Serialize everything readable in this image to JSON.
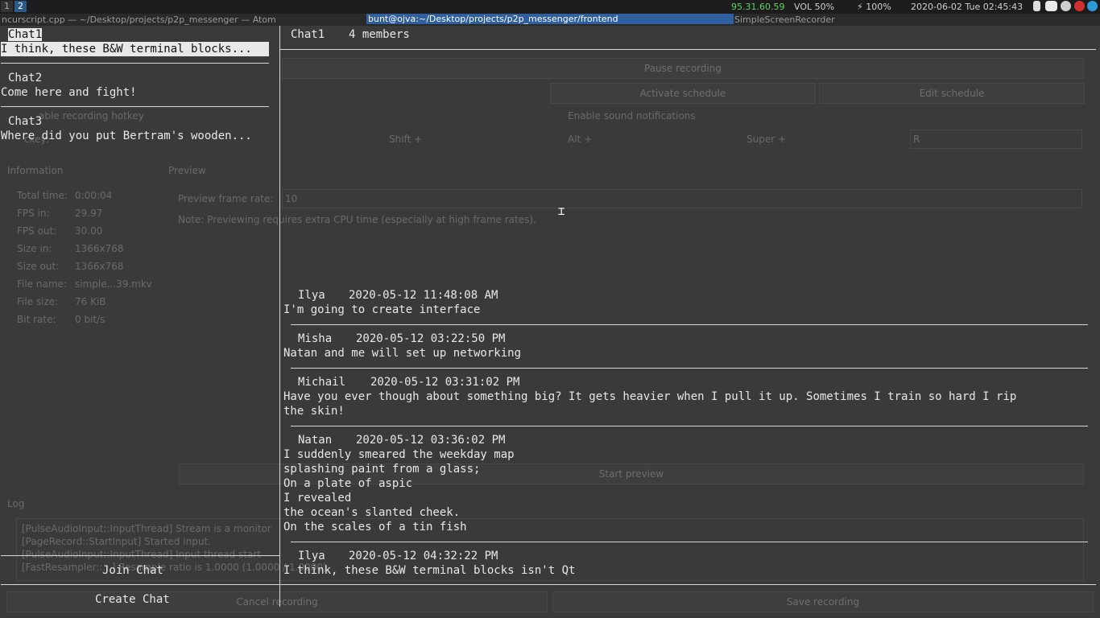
{
  "topbar": {
    "workspaces": [
      "1",
      "2"
    ],
    "ip": "95.31.60.59",
    "volume": "VOL 50%",
    "battery": "⚡ 100%",
    "datetime": "2020-06-02 Tue 02:45:43",
    "tray_icons": [
      "bluetooth-icon",
      "discord-icon",
      "steam-icon",
      "record-icon",
      "telegram-icon"
    ]
  },
  "windows": {
    "atom": "ncurscript.cpp — ~/Desktop/projects/p2p_messenger — Atom",
    "terminal": "bunt@ojva:~/Desktop/projects/p2p_messenger/frontend",
    "ssr": "SimpleScreenRecorder"
  },
  "background": {
    "pause_recording": "Pause recording",
    "activate_schedule": "Activate schedule",
    "edit_schedule": "Edit schedule",
    "enable_sound": "Enable sound notifications",
    "enable_hotkey": "able recording hotkey",
    "hotkey_label": "ckey:",
    "shift": "Shift +",
    "alt": "Alt +",
    "super": "Super +",
    "key": "R",
    "information": "Information",
    "preview": "Preview",
    "preview_rate_label": "Preview frame rate:",
    "preview_rate_value": "10",
    "preview_note": "Note: Previewing requires extra CPU time (especially at high frame rates).",
    "info_rows": [
      {
        "label": "Total time:",
        "value": "0:00:04"
      },
      {
        "label": "FPS in:",
        "value": "29.97"
      },
      {
        "label": "FPS out:",
        "value": "30.00"
      },
      {
        "label": "Size in:",
        "value": "1366x768"
      },
      {
        "label": "Size out:",
        "value": "1366x768"
      },
      {
        "label": "File name:",
        "value": "simple...39.mkv"
      },
      {
        "label": "File size:",
        "value": "76 KiB"
      },
      {
        "label": "Bit rate:",
        "value": "0 bit/s"
      }
    ],
    "start_preview": "Start preview",
    "log_label": "Log",
    "log_lines": [
      "[PulseAudioInput::InputThread] Stream is a monitor",
      "[PageRecord::StartInput] Started input.",
      "[PulseAudioInput::InputThread] Input thread start",
      "[FastResampler::...] Resample ratio is 1.0000 (1.0000 / 1.0000)"
    ],
    "cancel_recording": "Cancel recording",
    "save_recording": "Save recording"
  },
  "sidebar": {
    "chats": [
      {
        "name": "Chat1",
        "preview": "I think, these B&W terminal blocks..."
      },
      {
        "name": "Chat2",
        "preview": "Come here and fight!"
      },
      {
        "name": "Chat3",
        "preview": "Where did you put Bertram's wooden..."
      }
    ],
    "join_chat": "Join Chat",
    "create_chat": "Create Chat"
  },
  "chat": {
    "title": "Chat1",
    "members": "4 members",
    "messages": [
      {
        "author": "Ilya",
        "time": "2020-05-12 11:48:08 AM",
        "lines": [
          "I'm going to create interface"
        ]
      },
      {
        "author": "Misha",
        "time": "2020-05-12 03:22:50 PM",
        "lines": [
          "Natan and me will set up networking"
        ]
      },
      {
        "author": "Michail",
        "time": "2020-05-12 03:31:02 PM",
        "lines": [
          "Have you ever though about something big? It gets heavier when I pull it up. Sometimes I train so hard I rip",
          "the skin!"
        ]
      },
      {
        "author": "Natan",
        "time": "2020-05-12 03:36:02 PM",
        "lines": [
          "I suddenly smeared the weekday map",
          "splashing paint from a glass;",
          "On a plate of aspic",
          "I revealed",
          "the ocean's slanted cheek.",
          "On the scales of a tin fish"
        ]
      },
      {
        "author": "Ilya",
        "time": "2020-05-12 04:32:22 PM",
        "lines": [
          "I think, these B&W terminal blocks isn't Qt"
        ]
      }
    ]
  }
}
